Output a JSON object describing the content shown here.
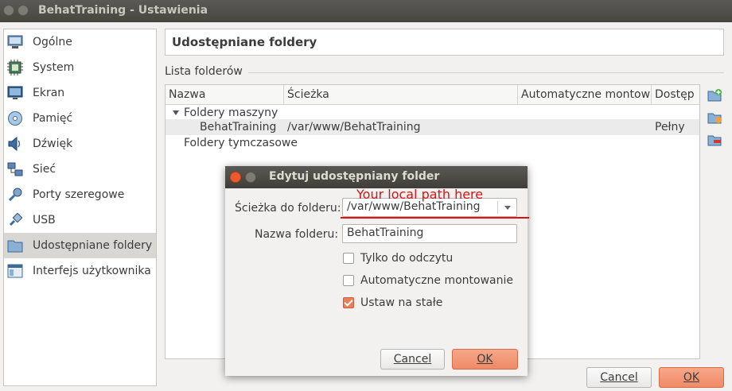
{
  "window": {
    "title": "BehatTraining - Ustawienia"
  },
  "sidebar": {
    "items": [
      {
        "label": "Ogólne",
        "icon": "general-icon"
      },
      {
        "label": "System",
        "icon": "system-chip-icon"
      },
      {
        "label": "Ekran",
        "icon": "display-icon"
      },
      {
        "label": "Pamięć",
        "icon": "storage-disk-icon"
      },
      {
        "label": "Dźwięk",
        "icon": "speaker-icon"
      },
      {
        "label": "Sieć",
        "icon": "network-icon"
      },
      {
        "label": "Porty szeregowe",
        "icon": "serial-port-icon"
      },
      {
        "label": "USB",
        "icon": "usb-icon"
      },
      {
        "label": "Udostępniane foldery",
        "icon": "shared-folder-icon",
        "selected": true
      },
      {
        "label": "Interfejs użytkownika",
        "icon": "user-interface-icon"
      }
    ]
  },
  "page": {
    "title": "Udostępniane foldery",
    "group_label": "Lista folderów"
  },
  "table": {
    "headers": [
      "Nazwa",
      "Ścieżka",
      "Automatyczne montowa",
      "Dostęp"
    ],
    "group1_label": "Foldery maszyny",
    "row1": {
      "name": "BehatTraining",
      "path": "/var/www/BehatTraining",
      "auto": "",
      "access": "Pełny"
    },
    "group2_label": "Foldery tymczasowe"
  },
  "tools": [
    "add-folder-icon",
    "edit-folder-icon",
    "remove-folder-icon"
  ],
  "buttons": {
    "cancel": "Cancel",
    "ok": "OK"
  },
  "dialog": {
    "title": "Edytuj udostępniany folder",
    "path_label": "Ścieżka do folderu:",
    "path_value": "/var/www/BehatTraining",
    "name_label": "Nazwa folderu:",
    "name_value": "BehatTraining",
    "readonly_label": "Tylko do odczytu",
    "readonly_checked": false,
    "automount_label": "Automatyczne montowanie",
    "automount_checked": false,
    "permanent_label": "Ustaw na stałe",
    "permanent_checked": true,
    "cancel_label": "Cancel",
    "ok_label": "OK"
  },
  "annotation": {
    "text": "Your local path here",
    "color": "#e01010"
  },
  "colors": {
    "accent": "#f08a66",
    "titlebar": "#47463f",
    "selection": "#d8d7d3"
  }
}
